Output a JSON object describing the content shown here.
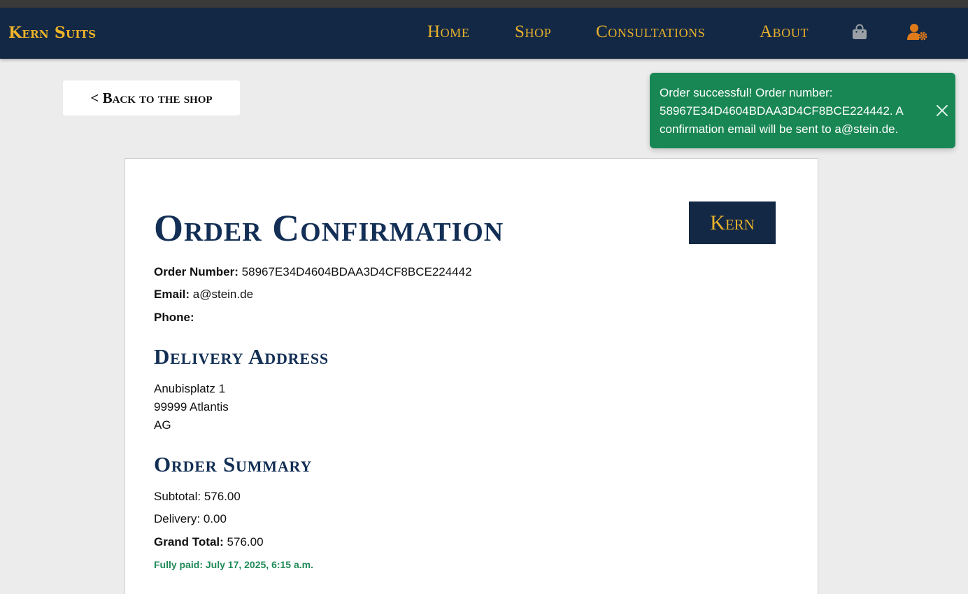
{
  "brand": "Kern Suits",
  "nav": {
    "home": "Home",
    "shop": "Shop",
    "consultations": "Consultations",
    "about": "About"
  },
  "icons": {
    "cart": "shopping-bag-icon",
    "account": "user-gear-icon",
    "close": "close-icon"
  },
  "back_button": "< Back to the shop",
  "toast": {
    "message": "Order successful! Order number: 58967E34D4604BDAA3D4CF8BCE224442. A confirmation email will be sent to a@stein.de."
  },
  "order": {
    "title": "Order Confirmation",
    "logo": "Kern",
    "order_number_label": "Order Number:",
    "order_number": "58967E34D4604BDAA3D4CF8BCE224442",
    "email_label": "Email:",
    "email": "a@stein.de",
    "phone_label": "Phone:",
    "phone": ""
  },
  "delivery": {
    "title": "Delivery Address",
    "street": "Anubisplatz 1",
    "city": "99999 Atlantis",
    "country": "AG"
  },
  "summary": {
    "title": "Order Summary",
    "subtotal": "Subtotal: 576.00",
    "delivery": "Delivery: 0.00",
    "grand_total_label": "Grand Total:",
    "grand_total": "576.00",
    "paid_status": "Fully paid: July 17, 2025, 6:15 a.m."
  },
  "colors": {
    "navbar": "#132844",
    "accent_gold": "#e8b12c",
    "success": "#198754",
    "heading": "#132f55",
    "icon_orange": "#e07b1a",
    "icon_grey": "#9aa0a6"
  }
}
